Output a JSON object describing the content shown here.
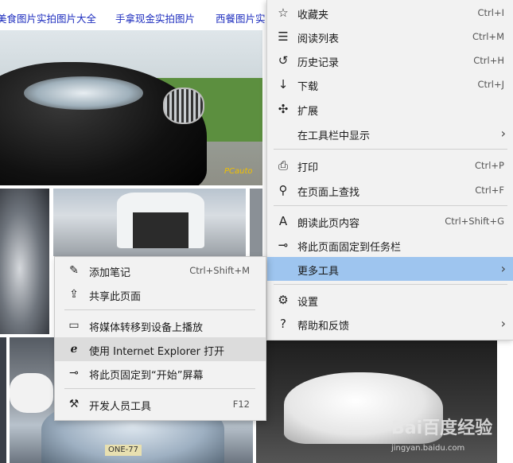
{
  "page": {
    "links": [
      "美食图片实拍图片大全",
      "手拿现金实拍图片",
      "西餐图片实"
    ],
    "photos": {
      "bmw_watermark": "PCauto",
      "aston_plate": "ONE-77",
      "audi_watermark": "Bai百度经验",
      "audi_watermark_url": "jingyan.baidu.com"
    }
  },
  "menu": {
    "items": [
      {
        "icon": "favorites-icon",
        "glyph": "☆",
        "label": "收藏夹",
        "shortcut": "Ctrl+I"
      },
      {
        "icon": "reading-list-icon",
        "glyph": "☰",
        "label": "阅读列表",
        "shortcut": "Ctrl+M"
      },
      {
        "icon": "history-icon",
        "glyph": "↺",
        "label": "历史记录",
        "shortcut": "Ctrl+H"
      },
      {
        "icon": "download-icon",
        "glyph": "↓",
        "label": "下载",
        "shortcut": "Ctrl+J"
      },
      {
        "icon": "extensions-icon",
        "glyph": "✣",
        "label": "扩展",
        "shortcut": ""
      },
      {
        "icon": "",
        "glyph": "",
        "label": "在工具栏中显示",
        "shortcut": ""
      },
      {
        "icon": "print-icon",
        "glyph": "⎙",
        "label": "打印",
        "shortcut": "Ctrl+P"
      },
      {
        "icon": "find-icon",
        "glyph": "⚲",
        "label": "在页面上查找",
        "shortcut": "Ctrl+F"
      },
      {
        "icon": "read-aloud-icon",
        "glyph": "A",
        "label": "朗读此页内容",
        "shortcut": "Ctrl+Shift+G"
      },
      {
        "icon": "pin-taskbar-icon",
        "glyph": "⊸",
        "label": "将此页面固定到任务栏",
        "shortcut": ""
      },
      {
        "icon": "",
        "glyph": "",
        "label": "更多工具",
        "shortcut": ""
      },
      {
        "icon": "settings-icon",
        "glyph": "⚙",
        "label": "设置",
        "shortcut": ""
      },
      {
        "icon": "help-icon",
        "glyph": "?",
        "label": "帮助和反馈",
        "shortcut": ""
      }
    ],
    "arrow": "›"
  },
  "submenu": {
    "items": [
      {
        "icon": "pen-icon",
        "glyph": "✎",
        "label": "添加笔记",
        "shortcut": "Ctrl+Shift+M"
      },
      {
        "icon": "share-icon",
        "glyph": "⇪",
        "label": "共享此页面",
        "shortcut": ""
      },
      {
        "icon": "cast-icon",
        "glyph": "▭",
        "label": "将媒体转移到设备上播放",
        "shortcut": ""
      },
      {
        "icon": "internet-explorer-icon",
        "glyph": "e",
        "label": "使用 Internet Explorer 打开",
        "shortcut": ""
      },
      {
        "icon": "pin-start-icon",
        "glyph": "⊸",
        "label": "将此页固定到“开始”屏幕",
        "shortcut": ""
      },
      {
        "icon": "dev-tools-icon",
        "glyph": "⚒",
        "label": "开发人员工具",
        "shortcut": "F12"
      }
    ]
  }
}
